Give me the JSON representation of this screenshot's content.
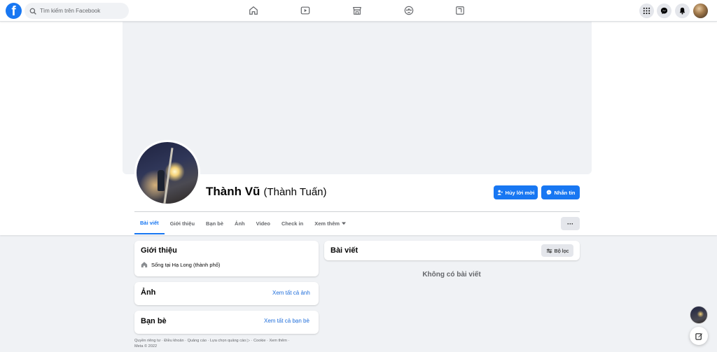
{
  "search": {
    "placeholder": "Tìm kiếm trên Facebook"
  },
  "topnav": {
    "logo": "f",
    "center_icons": [
      "home-icon",
      "watch-icon",
      "marketplace-icon",
      "groups-icon",
      "gaming-icon"
    ],
    "right_icons": [
      "menu-grid-icon",
      "messenger-icon",
      "notifications-icon",
      "profile-avatar"
    ]
  },
  "profile": {
    "name": "Thành Vũ",
    "alt_name": "(Thành Tuấn)",
    "cancel_request_label": "Hủy lời mời",
    "message_label": "Nhắn tin",
    "more_label": "···"
  },
  "tabs": [
    {
      "label": "Bài viết",
      "active": true
    },
    {
      "label": "Giới thiệu"
    },
    {
      "label": "Bạn bè"
    },
    {
      "label": "Ảnh"
    },
    {
      "label": "Video"
    },
    {
      "label": "Check in"
    },
    {
      "label": "Xem thêm"
    }
  ],
  "intro": {
    "title": "Giới thiệu",
    "lives_prefix": "Sống tại ",
    "lives_place": "Hạ Long (thành phố)"
  },
  "photos": {
    "title": "Ảnh",
    "link": "Xem tất cả ảnh"
  },
  "friends": {
    "title": "Bạn bè",
    "link": "Xem tất cả bạn bè"
  },
  "posts": {
    "title": "Bài viết",
    "filter_label": "Bộ lọc",
    "empty": "Không có bài viết"
  },
  "footer": {
    "line1": "Quyền riêng tư · Điều khoản · Quảng cáo · Lựa chọn quảng cáo ▷ · Cookie · Xem thêm ·",
    "line2": "Meta © 2022"
  },
  "colors": {
    "brand": "#1877f2",
    "link": "#216fdb",
    "background": "#f0f2f5"
  }
}
